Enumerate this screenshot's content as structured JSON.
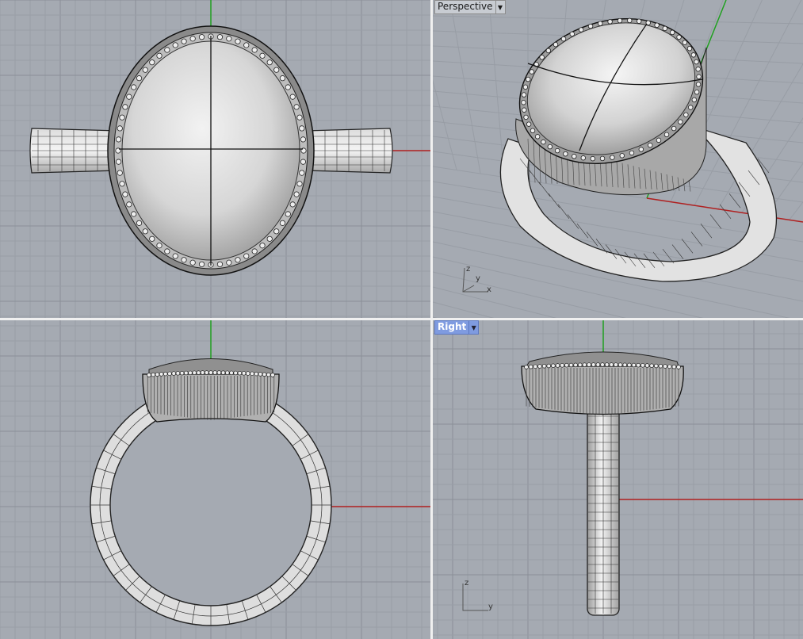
{
  "viewports": {
    "top": {
      "title": ""
    },
    "perspective": {
      "title": "Perspective",
      "dropdown_icon": "chevron-down-icon"
    },
    "front": {
      "title": ""
    },
    "right": {
      "title": "Right",
      "dropdown_icon": "chevron-down-icon",
      "active": true
    }
  },
  "axis_labels": {
    "perspective": {
      "z": "z",
      "y": "y",
      "x": "x"
    },
    "right": {
      "z": "z",
      "y": "y"
    }
  },
  "colors": {
    "viewport_bg": "#a5aab2",
    "x_axis": "#b02020",
    "y_axis": "#20a020",
    "active_title_bg": "#7f9be0"
  }
}
